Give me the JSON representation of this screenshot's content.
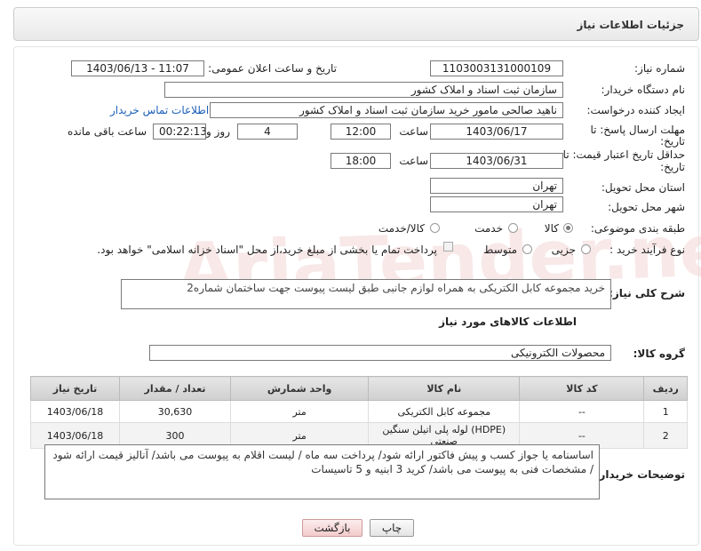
{
  "header": {
    "title": "جزئیات اطلاعات نیاز"
  },
  "form": {
    "need_number_label": "شماره نیاز:",
    "need_number": "1103003131000109",
    "announce_label": "تاریخ و ساعت اعلان عمومی:",
    "announce_value": "1403/06/13 - 11:07",
    "buyer_org_label": "نام دستگاه خریدار:",
    "buyer_org": "سازمان ثبت اسناد و املاک کشور",
    "creator_label": "ایجاد کننده درخواست:",
    "creator": "ناهید صالحی مامور خرید سازمان ثبت اسناد و املاک کشور",
    "contact_link": "اطلاعات تماس خریدار",
    "deadline_label_1": "مهلت ارسال پاسخ: تا",
    "deadline_label_2": "تاریخ:",
    "deadline_date": "1403/06/17",
    "time_label": "ساعت",
    "deadline_time": "12:00",
    "days_value": "4",
    "days_label": "روز و",
    "remain_time": "00:22:13",
    "remain_label": "ساعت باقی مانده",
    "validity_label_1": "حداقل تاریخ اعتبار قیمت: تا",
    "validity_label_2": "تاریخ:",
    "validity_date": "1403/06/31",
    "validity_time": "18:00",
    "province_label": "استان محل تحویل:",
    "province": "تهران",
    "city_label": "شهر محل تحویل:",
    "city": "تهران",
    "category_label": "طبقه بندی موضوعی:",
    "cat_goods": "کالا",
    "cat_service": "خدمت",
    "cat_both": "کالا/خدمت",
    "process_label": "نوع فرآیند خرید :",
    "proc_partial": "جزیی",
    "proc_medium": "متوسط",
    "payment_note": "پرداخت تمام یا بخشی از مبلغ خرید،از محل \"اسناد خزانه اسلامی\" خواهد بود.",
    "desc_label": "شرح کلی نیاز:",
    "desc": "خرید مجموعه کابل الکتریکی به همراه لوازم جانبی طبق لیست پیوست جهت ساختمان شماره2",
    "goods_info_title": "اطلاعات کالاهای مورد نیاز",
    "goods_group_label": "گروه کالا:",
    "goods_group": "محصولات الکترونیکی",
    "notes_label": "توضیحات خریدار:",
    "notes": "اساسنامه یا جواز کسب و پیش فاکتور ارائه شود/ پرداخت سه ماه / لیست اقلام به پیوست می باشد/ آنالیز قیمت ارائه شود / مشخصات فنی به پیوست می باشد/ کرید 3 ابنیه و 5 تاسیسات"
  },
  "table": {
    "headers": [
      "ردیف",
      "کد کالا",
      "نام کالا",
      "واحد شمارش",
      "تعداد / مقدار",
      "تاریخ نیاز"
    ],
    "rows": [
      [
        "1",
        "--",
        "مجموعه کابل الکتریکی",
        "متر",
        "30,630",
        "1403/06/18"
      ],
      [
        "2",
        "--",
        "لوله پلی اتیلن سنگین (HDPE) صنعتی",
        "متر",
        "300",
        "1403/06/18"
      ]
    ]
  },
  "buttons": {
    "print": "چاپ",
    "back": "بازگشت"
  },
  "watermark": "AriaTender.neT"
}
